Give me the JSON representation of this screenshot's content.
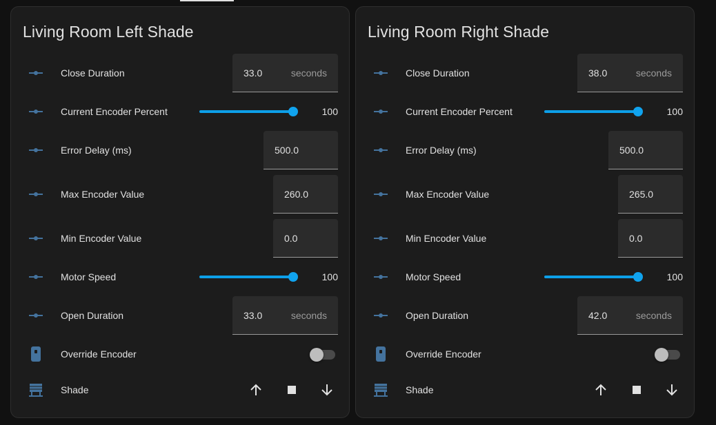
{
  "cards": [
    {
      "title": "Living Room Left Shade",
      "close_duration": {
        "label": "Close Duration",
        "value": "33.0",
        "unit": "seconds"
      },
      "current_encoder_percent": {
        "label": "Current Encoder Percent",
        "value": "100",
        "fraction": 1.0
      },
      "error_delay": {
        "label": "Error Delay (ms)",
        "value": "500.0"
      },
      "max_encoder": {
        "label": "Max Encoder Value",
        "value": "260.0"
      },
      "min_encoder": {
        "label": "Min Encoder Value",
        "value": "0.0"
      },
      "motor_speed": {
        "label": "Motor Speed",
        "value": "100",
        "fraction": 1.0
      },
      "open_duration": {
        "label": "Open Duration",
        "value": "33.0",
        "unit": "seconds"
      },
      "override_encoder": {
        "label": "Override Encoder",
        "state": "off"
      },
      "shade": {
        "label": "Shade"
      }
    },
    {
      "title": "Living Room Right Shade",
      "close_duration": {
        "label": "Close Duration",
        "value": "38.0",
        "unit": "seconds"
      },
      "current_encoder_percent": {
        "label": "Current Encoder Percent",
        "value": "100",
        "fraction": 1.0
      },
      "error_delay": {
        "label": "Error Delay (ms)",
        "value": "500.0"
      },
      "max_encoder": {
        "label": "Max Encoder Value",
        "value": "265.0"
      },
      "min_encoder": {
        "label": "Min Encoder Value",
        "value": "0.0"
      },
      "motor_speed": {
        "label": "Motor Speed",
        "value": "100",
        "fraction": 1.0
      },
      "open_duration": {
        "label": "Open Duration",
        "value": "42.0",
        "unit": "seconds"
      },
      "override_encoder": {
        "label": "Override Encoder",
        "state": "off"
      },
      "shade": {
        "label": "Shade"
      }
    }
  ],
  "colors": {
    "accent": "#0d9fe8",
    "icon": "#44739e",
    "card_bg": "#1c1c1c",
    "page_bg": "#111111"
  },
  "icons": {
    "number_entity": "ray-vertex-icon",
    "switch_entity": "remote-icon",
    "cover_entity": "window-shutter-icon",
    "open": "arrow-up-icon",
    "stop": "stop-icon",
    "close": "arrow-down-icon"
  }
}
